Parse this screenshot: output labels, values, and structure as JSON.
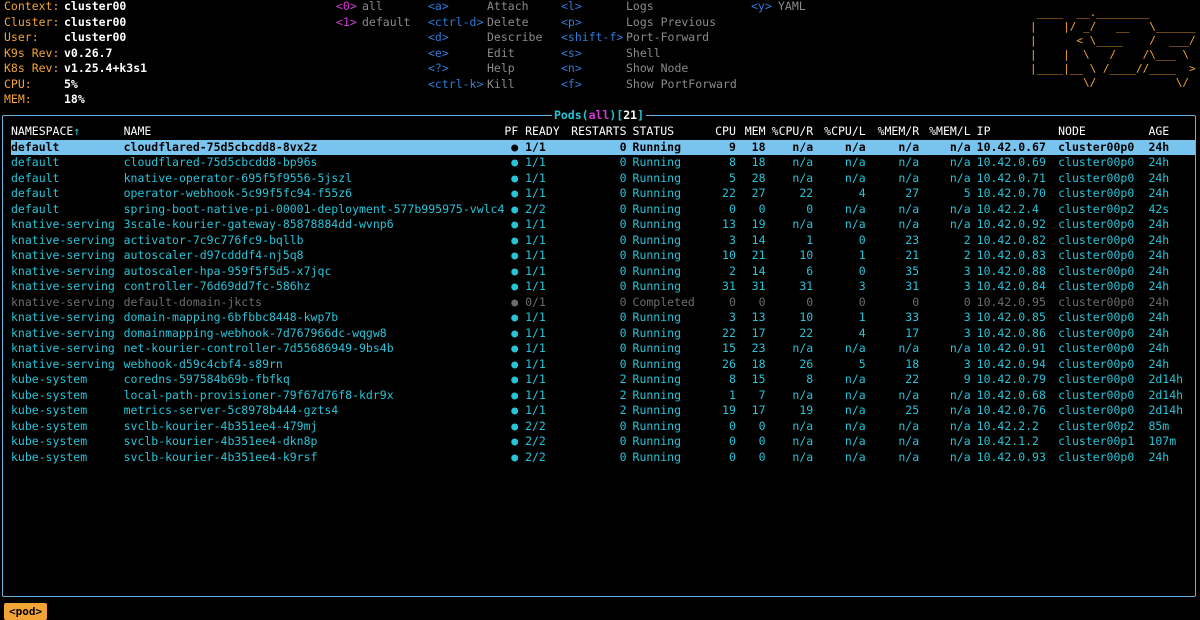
{
  "info": [
    {
      "label": "Context:",
      "value": "cluster00"
    },
    {
      "label": "Cluster:",
      "value": "cluster00"
    },
    {
      "label": "User:",
      "value": "cluster00"
    },
    {
      "label": "K9s Rev:",
      "value": "v0.26.7"
    },
    {
      "label": "K8s Rev:",
      "value": "v1.25.4+k3s1"
    },
    {
      "label": "CPU:",
      "value": "5%"
    },
    {
      "label": "MEM:",
      "value": "18%"
    }
  ],
  "namespaces": [
    {
      "key": "<0>",
      "name": "all"
    },
    {
      "key": "<1>",
      "name": "default"
    }
  ],
  "hotkeys_col1": [
    {
      "key": "<a>",
      "label": "Attach"
    },
    {
      "key": "<ctrl-d>",
      "label": "Delete"
    },
    {
      "key": "<d>",
      "label": "Describe"
    },
    {
      "key": "<e>",
      "label": "Edit"
    },
    {
      "key": "<?>",
      "label": "Help"
    },
    {
      "key": "<ctrl-k>",
      "label": "Kill"
    }
  ],
  "hotkeys_col2": [
    {
      "key": "<l>",
      "label": "Logs"
    },
    {
      "key": "<p>",
      "label": "Logs Previous"
    },
    {
      "key": "<shift-f>",
      "label": "Port-Forward"
    },
    {
      "key": "<s>",
      "label": "Shell"
    },
    {
      "key": "<n>",
      "label": "Show Node"
    },
    {
      "key": "<f>",
      "label": "Show PortForward"
    }
  ],
  "hotkeys_col3": [
    {
      "key": "<y>",
      "label": "YAML"
    }
  ],
  "logo_lines": [
    " ____  __.________        ",
    "|    |/ _/   __   \\______ ",
    "|      < \\____    /  ___/ ",
    "|    |  \\   /    /\\___ \\  ",
    "|____|__ \\ /____//____  > ",
    "        \\/            \\/  "
  ],
  "title": {
    "resource": "Pods",
    "open": "(",
    "filter": "all",
    "close": ")",
    "count_open": "[",
    "count": "21",
    "count_close": "]"
  },
  "columns": [
    "NAMESPACE",
    "↑",
    "NAME",
    "PF",
    "READY",
    "RESTARTS",
    "STATUS",
    "CPU",
    "MEM",
    "%CPU/R",
    "%CPU/L",
    "%MEM/R",
    "%MEM/L",
    "IP",
    "NODE",
    "AGE"
  ],
  "rows": [
    {
      "ns": "default",
      "name": "cloudflared-75d5cbcdd8-8vx2z",
      "pf": "●",
      "ready": "1/1",
      "restarts": "0",
      "status": "Running",
      "cpu": "9",
      "mem": "18",
      "cpur": "n/a",
      "cpul": "n/a",
      "memr": "n/a",
      "meml": "n/a",
      "ip": "10.42.0.67",
      "node": "cluster00p0",
      "age": "24h"
    },
    {
      "ns": "default",
      "name": "cloudflared-75d5cbcdd8-bp96s",
      "pf": "●",
      "ready": "1/1",
      "restarts": "0",
      "status": "Running",
      "cpu": "8",
      "mem": "18",
      "cpur": "n/a",
      "cpul": "n/a",
      "memr": "n/a",
      "meml": "n/a",
      "ip": "10.42.0.69",
      "node": "cluster00p0",
      "age": "24h"
    },
    {
      "ns": "default",
      "name": "knative-operator-695f5f9556-5jszl",
      "pf": "●",
      "ready": "1/1",
      "restarts": "0",
      "status": "Running",
      "cpu": "5",
      "mem": "28",
      "cpur": "n/a",
      "cpul": "n/a",
      "memr": "n/a",
      "meml": "n/a",
      "ip": "10.42.0.71",
      "node": "cluster00p0",
      "age": "24h"
    },
    {
      "ns": "default",
      "name": "operator-webhook-5c99f5fc94-f55z6",
      "pf": "●",
      "ready": "1/1",
      "restarts": "0",
      "status": "Running",
      "cpu": "22",
      "mem": "27",
      "cpur": "22",
      "cpul": "4",
      "memr": "27",
      "meml": "5",
      "ip": "10.42.0.70",
      "node": "cluster00p0",
      "age": "24h"
    },
    {
      "ns": "default",
      "name": "spring-boot-native-pi-00001-deployment-577b995975-vwlc4",
      "pf": "●",
      "ready": "2/2",
      "restarts": "0",
      "status": "Running",
      "cpu": "0",
      "mem": "0",
      "cpur": "0",
      "cpul": "n/a",
      "memr": "n/a",
      "meml": "n/a",
      "ip": "10.42.2.4",
      "node": "cluster00p2",
      "age": "42s"
    },
    {
      "ns": "knative-serving",
      "name": "3scale-kourier-gateway-85878884dd-wvnp6",
      "pf": "●",
      "ready": "1/1",
      "restarts": "0",
      "status": "Running",
      "cpu": "13",
      "mem": "19",
      "cpur": "n/a",
      "cpul": "n/a",
      "memr": "n/a",
      "meml": "n/a",
      "ip": "10.42.0.92",
      "node": "cluster00p0",
      "age": "24h"
    },
    {
      "ns": "knative-serving",
      "name": "activator-7c9c776fc9-bqllb",
      "pf": "●",
      "ready": "1/1",
      "restarts": "0",
      "status": "Running",
      "cpu": "3",
      "mem": "14",
      "cpur": "1",
      "cpul": "0",
      "memr": "23",
      "meml": "2",
      "ip": "10.42.0.82",
      "node": "cluster00p0",
      "age": "24h"
    },
    {
      "ns": "knative-serving",
      "name": "autoscaler-d97cdddf4-nj5q8",
      "pf": "●",
      "ready": "1/1",
      "restarts": "0",
      "status": "Running",
      "cpu": "10",
      "mem": "21",
      "cpur": "10",
      "cpul": "1",
      "memr": "21",
      "meml": "2",
      "ip": "10.42.0.83",
      "node": "cluster00p0",
      "age": "24h"
    },
    {
      "ns": "knative-serving",
      "name": "autoscaler-hpa-959f5f5d5-x7jqc",
      "pf": "●",
      "ready": "1/1",
      "restarts": "0",
      "status": "Running",
      "cpu": "2",
      "mem": "14",
      "cpur": "6",
      "cpul": "0",
      "memr": "35",
      "meml": "3",
      "ip": "10.42.0.88",
      "node": "cluster00p0",
      "age": "24h"
    },
    {
      "ns": "knative-serving",
      "name": "controller-76d69dd7fc-586hz",
      "pf": "●",
      "ready": "1/1",
      "restarts": "0",
      "status": "Running",
      "cpu": "31",
      "mem": "31",
      "cpur": "31",
      "cpul": "3",
      "memr": "31",
      "meml": "3",
      "ip": "10.42.0.84",
      "node": "cluster00p0",
      "age": "24h"
    },
    {
      "ns": "knative-serving",
      "name": "default-domain-jkcts",
      "pf": "●",
      "ready": "0/1",
      "restarts": "0",
      "status": "Completed",
      "cpu": "0",
      "mem": "0",
      "cpur": "0",
      "cpul": "0",
      "memr": "0",
      "meml": "0",
      "ip": "10.42.0.95",
      "node": "cluster00p0",
      "age": "24h",
      "dim": true
    },
    {
      "ns": "knative-serving",
      "name": "domain-mapping-6bfbbc8448-kwp7b",
      "pf": "●",
      "ready": "1/1",
      "restarts": "0",
      "status": "Running",
      "cpu": "3",
      "mem": "13",
      "cpur": "10",
      "cpul": "1",
      "memr": "33",
      "meml": "3",
      "ip": "10.42.0.85",
      "node": "cluster00p0",
      "age": "24h"
    },
    {
      "ns": "knative-serving",
      "name": "domainmapping-webhook-7d767966dc-wqgw8",
      "pf": "●",
      "ready": "1/1",
      "restarts": "0",
      "status": "Running",
      "cpu": "22",
      "mem": "17",
      "cpur": "22",
      "cpul": "4",
      "memr": "17",
      "meml": "3",
      "ip": "10.42.0.86",
      "node": "cluster00p0",
      "age": "24h"
    },
    {
      "ns": "knative-serving",
      "name": "net-kourier-controller-7d55686949-9bs4b",
      "pf": "●",
      "ready": "1/1",
      "restarts": "0",
      "status": "Running",
      "cpu": "15",
      "mem": "23",
      "cpur": "n/a",
      "cpul": "n/a",
      "memr": "n/a",
      "meml": "n/a",
      "ip": "10.42.0.91",
      "node": "cluster00p0",
      "age": "24h"
    },
    {
      "ns": "knative-serving",
      "name": "webhook-d59c4cbf4-s89rn",
      "pf": "●",
      "ready": "1/1",
      "restarts": "0",
      "status": "Running",
      "cpu": "26",
      "mem": "18",
      "cpur": "26",
      "cpul": "5",
      "memr": "18",
      "meml": "3",
      "ip": "10.42.0.94",
      "node": "cluster00p0",
      "age": "24h"
    },
    {
      "ns": "kube-system",
      "name": "coredns-597584b69b-fbfkq",
      "pf": "●",
      "ready": "1/1",
      "restarts": "2",
      "status": "Running",
      "cpu": "8",
      "mem": "15",
      "cpur": "8",
      "cpul": "n/a",
      "memr": "22",
      "meml": "9",
      "ip": "10.42.0.79",
      "node": "cluster00p0",
      "age": "2d14h"
    },
    {
      "ns": "kube-system",
      "name": "local-path-provisioner-79f67d76f8-kdr9x",
      "pf": "●",
      "ready": "1/1",
      "restarts": "2",
      "status": "Running",
      "cpu": "1",
      "mem": "7",
      "cpur": "n/a",
      "cpul": "n/a",
      "memr": "n/a",
      "meml": "n/a",
      "ip": "10.42.0.68",
      "node": "cluster00p0",
      "age": "2d14h"
    },
    {
      "ns": "kube-system",
      "name": "metrics-server-5c8978b444-gzts4",
      "pf": "●",
      "ready": "1/1",
      "restarts": "2",
      "status": "Running",
      "cpu": "19",
      "mem": "17",
      "cpur": "19",
      "cpul": "n/a",
      "memr": "25",
      "meml": "n/a",
      "ip": "10.42.0.76",
      "node": "cluster00p0",
      "age": "2d14h"
    },
    {
      "ns": "kube-system",
      "name": "svclb-kourier-4b351ee4-479mj",
      "pf": "●",
      "ready": "2/2",
      "restarts": "0",
      "status": "Running",
      "cpu": "0",
      "mem": "0",
      "cpur": "n/a",
      "cpul": "n/a",
      "memr": "n/a",
      "meml": "n/a",
      "ip": "10.42.2.2",
      "node": "cluster00p2",
      "age": "85m"
    },
    {
      "ns": "kube-system",
      "name": "svclb-kourier-4b351ee4-dkn8p",
      "pf": "●",
      "ready": "2/2",
      "restarts": "0",
      "status": "Running",
      "cpu": "0",
      "mem": "0",
      "cpur": "n/a",
      "cpul": "n/a",
      "memr": "n/a",
      "meml": "n/a",
      "ip": "10.42.1.2",
      "node": "cluster00p1",
      "age": "107m"
    },
    {
      "ns": "kube-system",
      "name": "svclb-kourier-4b351ee4-k9rsf",
      "pf": "●",
      "ready": "2/2",
      "restarts": "0",
      "status": "Running",
      "cpu": "0",
      "mem": "0",
      "cpur": "n/a",
      "cpul": "n/a",
      "memr": "n/a",
      "meml": "n/a",
      "ip": "10.42.0.93",
      "node": "cluster00p0",
      "age": "24h"
    }
  ],
  "crumb": "<pod>",
  "colors": {
    "accent": "#27c4d8",
    "selected": "#79c4ee",
    "orange": "#f2a435",
    "border": "#6ab4e2",
    "magenta": "#d63bd6",
    "hotkey": "#2f7bd8"
  }
}
